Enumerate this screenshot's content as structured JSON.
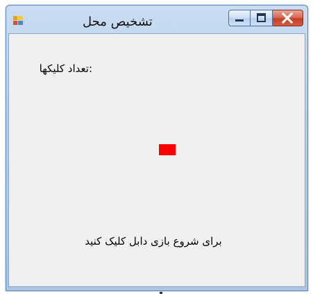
{
  "window": {
    "title": "تشخیص محل"
  },
  "content": {
    "click_count_label": ":تعداد کلیکها",
    "instruction": "برای شروع بازی دابل کلیک کنید"
  },
  "icons": {
    "app": "app-icon",
    "minimize": "minimize-icon",
    "maximize": "maximize-icon",
    "close": "close-icon"
  },
  "colors": {
    "target": "#ff0000",
    "client_background": "#f0f0f0",
    "close_button": "#c4402a"
  }
}
